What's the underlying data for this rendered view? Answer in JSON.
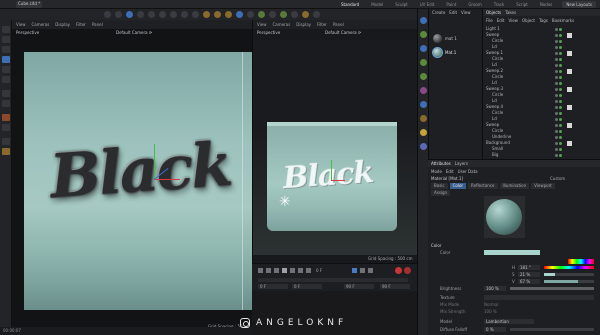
{
  "topbar": {
    "file_tab": "Cube.c4d *",
    "layouts": [
      "Standard",
      "Model",
      "Sculpt",
      "UV Edit",
      "Paint",
      "Groom",
      "Track",
      "Script",
      "Nodes"
    ],
    "active_layout": "Standard",
    "new_layouts": "New Layouts"
  },
  "viewport_left": {
    "menu": [
      "View",
      "Cameras",
      "Display",
      "Filter",
      "Panel"
    ],
    "projection": "Perspective",
    "camera": "Default Camera ⟳",
    "grid_status": "Grid Spacing : 50",
    "status_time": "00:00:07",
    "scene_text": "Black"
  },
  "viewport_right": {
    "menu": [
      "View",
      "Cameras",
      "Display",
      "Filter",
      "Panel"
    ],
    "projection": "Perspective",
    "camera": "Default Camera ⟳",
    "grid_status": "Grid Spacing : 500 cm",
    "scene_text": "Black"
  },
  "timeline": {
    "frame_start": "0 F",
    "frame_current": "0 F",
    "frame_end": "90 F",
    "frame_end2": "90 F",
    "frame_field": "0 F"
  },
  "material_manager": {
    "menu": [
      "Create",
      "Edit",
      "View"
    ],
    "materials": [
      "mat 1",
      "Mat.1"
    ]
  },
  "object_manager": {
    "tabs": [
      "Objects",
      "Takes"
    ],
    "menu": [
      "File",
      "Edit",
      "View",
      "Object",
      "Tags",
      "Bookmarks"
    ],
    "objects": [
      "Light 1",
      "Sweep",
      "Circle",
      "Ld",
      "Sweep.1",
      "Circle",
      "Ld",
      "Sweep.2",
      "Circle",
      "Ld",
      "Sweep.3",
      "Circle",
      "Ld",
      "Sweep.4",
      "Circle",
      "Ld",
      "Sweep",
      "Circle",
      "Underline",
      "Background",
      "Small",
      "Big"
    ]
  },
  "attributes": {
    "tabs": [
      "Attributes",
      "Layers"
    ],
    "menu": [
      "Mode",
      "Edit",
      "User Data"
    ],
    "material_name": "Material [Mat.1]",
    "custom": "Custom",
    "subtabs": [
      "Basic",
      "Color",
      "Reflectance",
      "Illumination",
      "Viewport"
    ],
    "subtab2": "Assign",
    "active_subtab": "Color",
    "section_color": "Color",
    "color_label": "Color",
    "h_value": "181 °",
    "s_value": "21 %",
    "v_value": "67 %",
    "brightness_label": "Brightness",
    "brightness_value": "100 %",
    "texture_label": "Texture",
    "mix_mode_label": "Mix Mode",
    "mix_mode_value": "Normal",
    "mix_strength_label": "Mix Strength",
    "mix_strength_value": "100 %",
    "model_label": "Model",
    "model_value": "Lambertian",
    "diffuse_falloff_label": "Diffuse Falloff",
    "diffuse_falloff_value": "0 %",
    "swatch_color": "#a9d3cd"
  },
  "watermark": {
    "text": "ANGELOKNF",
    "icon": "instagram-icon"
  },
  "colors": {
    "accent": "#3a5d8f",
    "axis_x": "#d83c3c",
    "axis_y": "#42c242",
    "axis_z": "#3f6bd8",
    "record": "#c63636"
  }
}
